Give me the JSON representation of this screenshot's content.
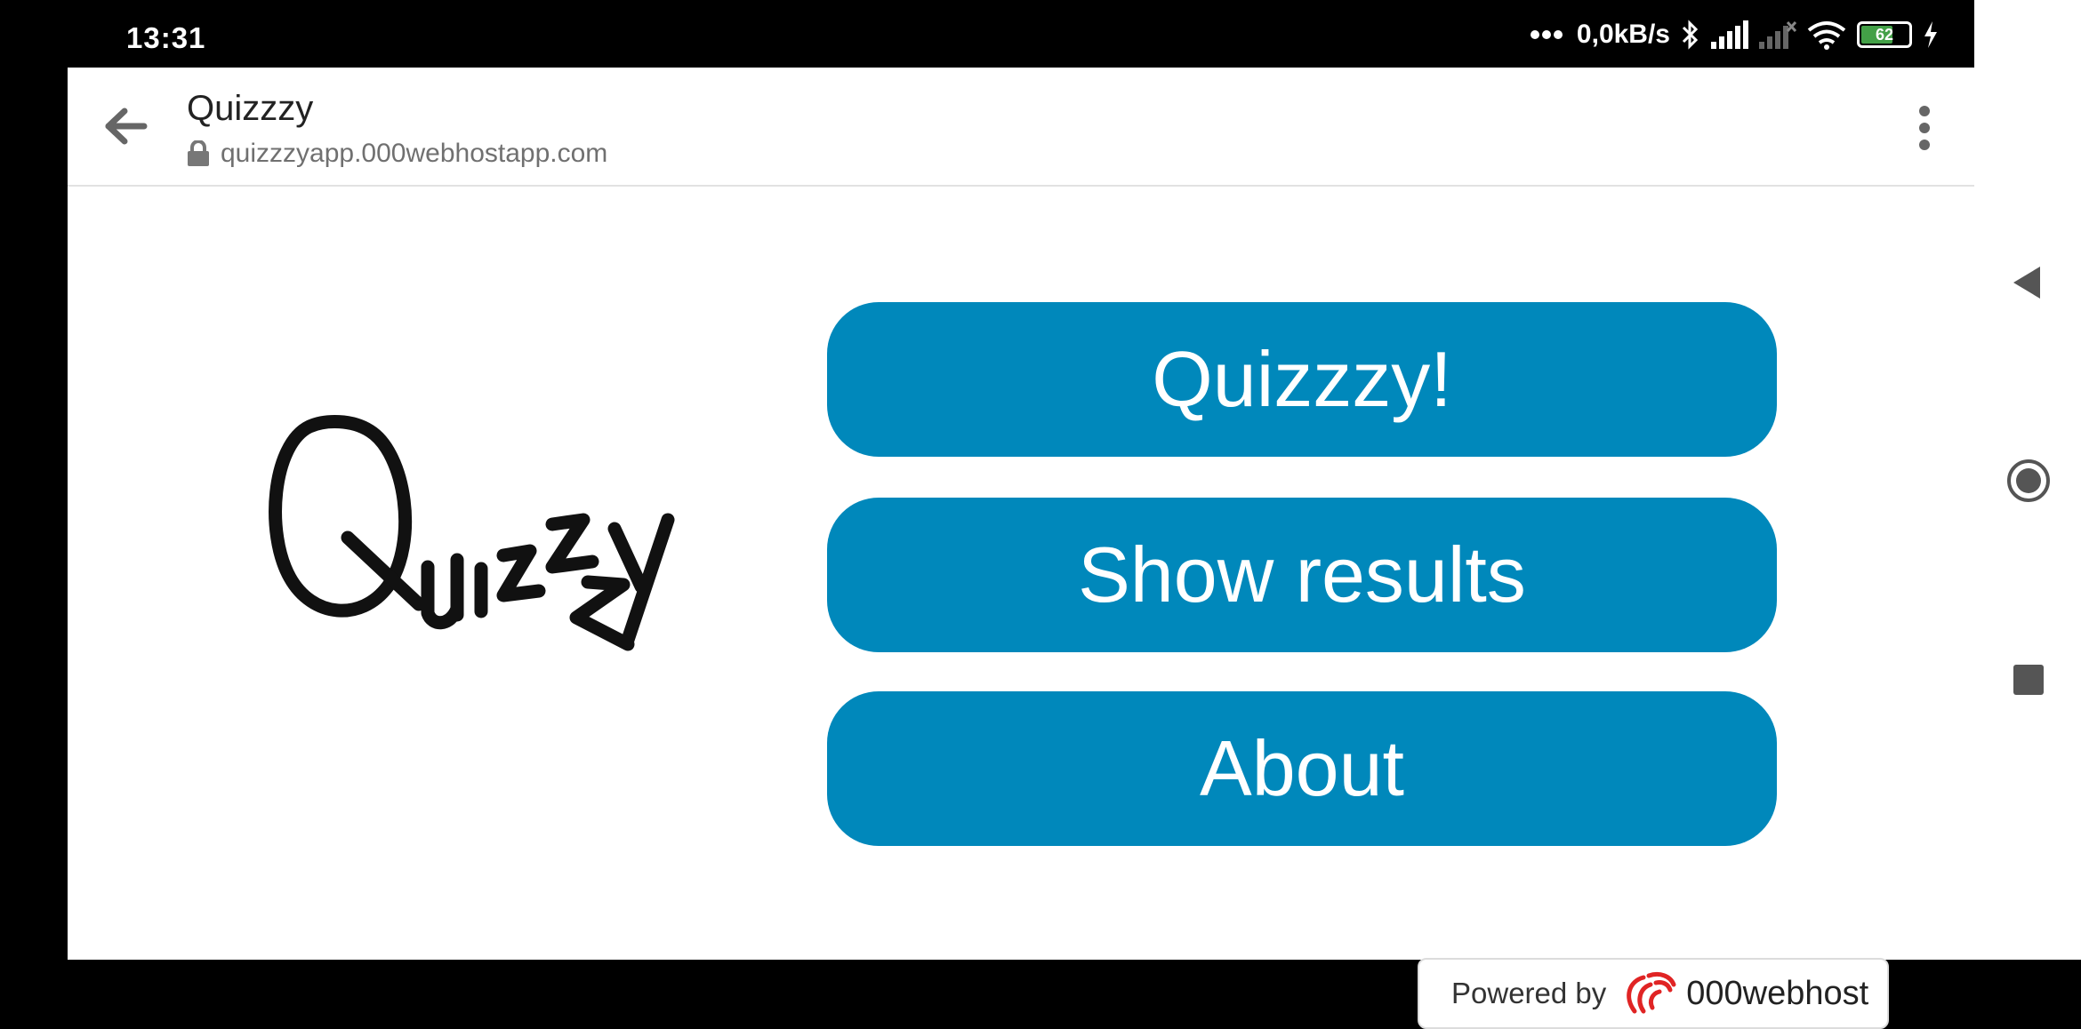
{
  "status_bar": {
    "time": "13:31",
    "speed": "0,0kB/s",
    "battery": "62"
  },
  "browser": {
    "title": "Quizzzy",
    "url": "quizzzyapp.000webhostapp.com"
  },
  "menu": {
    "buttons": [
      "Quizzzy!",
      "Show results",
      "About"
    ],
    "button_color": "#0088bb"
  },
  "logo_text": "Quizzzy",
  "footer": {
    "powered_by": "Powered by",
    "brand": "000webhost"
  }
}
